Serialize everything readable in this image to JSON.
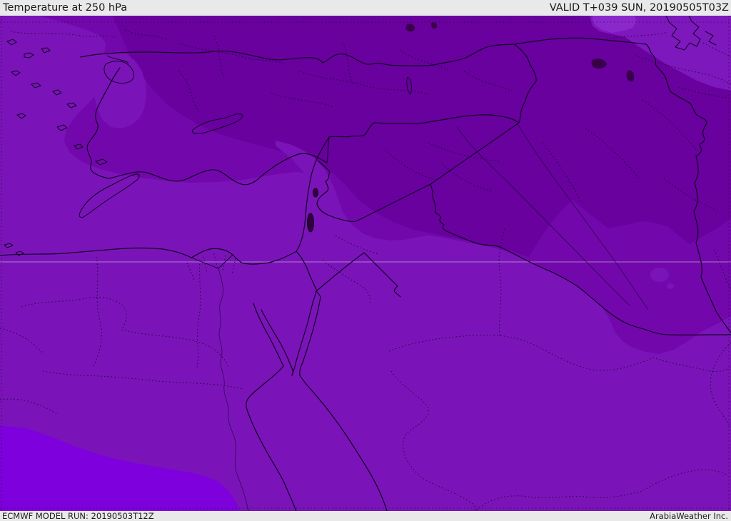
{
  "header": {
    "title": "Temperature at 250 hPa",
    "valid": "VALID T+039 SUN, 20190505T03Z"
  },
  "footer": {
    "model_run": "ECMWF MODEL RUN: 20190503T12Z",
    "credit": "ArabiaWeather Inc."
  },
  "map": {
    "parameter": "Temperature",
    "level": "250 hPa",
    "model": "ECMWF",
    "colors": {
      "base": "#7a14b8",
      "band_cold": "#7208ab",
      "band_coldest": "#68019e",
      "band_warm": "#7e00dc",
      "corner_light": "#7d18bd",
      "sliver_light": "#8b28cc",
      "bar_bg": "#e9e9e9",
      "bar_text": "#1b1b1b",
      "border_line": "#140024",
      "admin_dotted": "#1e0534",
      "graticule": "#decfe8",
      "lake": "#33003f"
    }
  }
}
